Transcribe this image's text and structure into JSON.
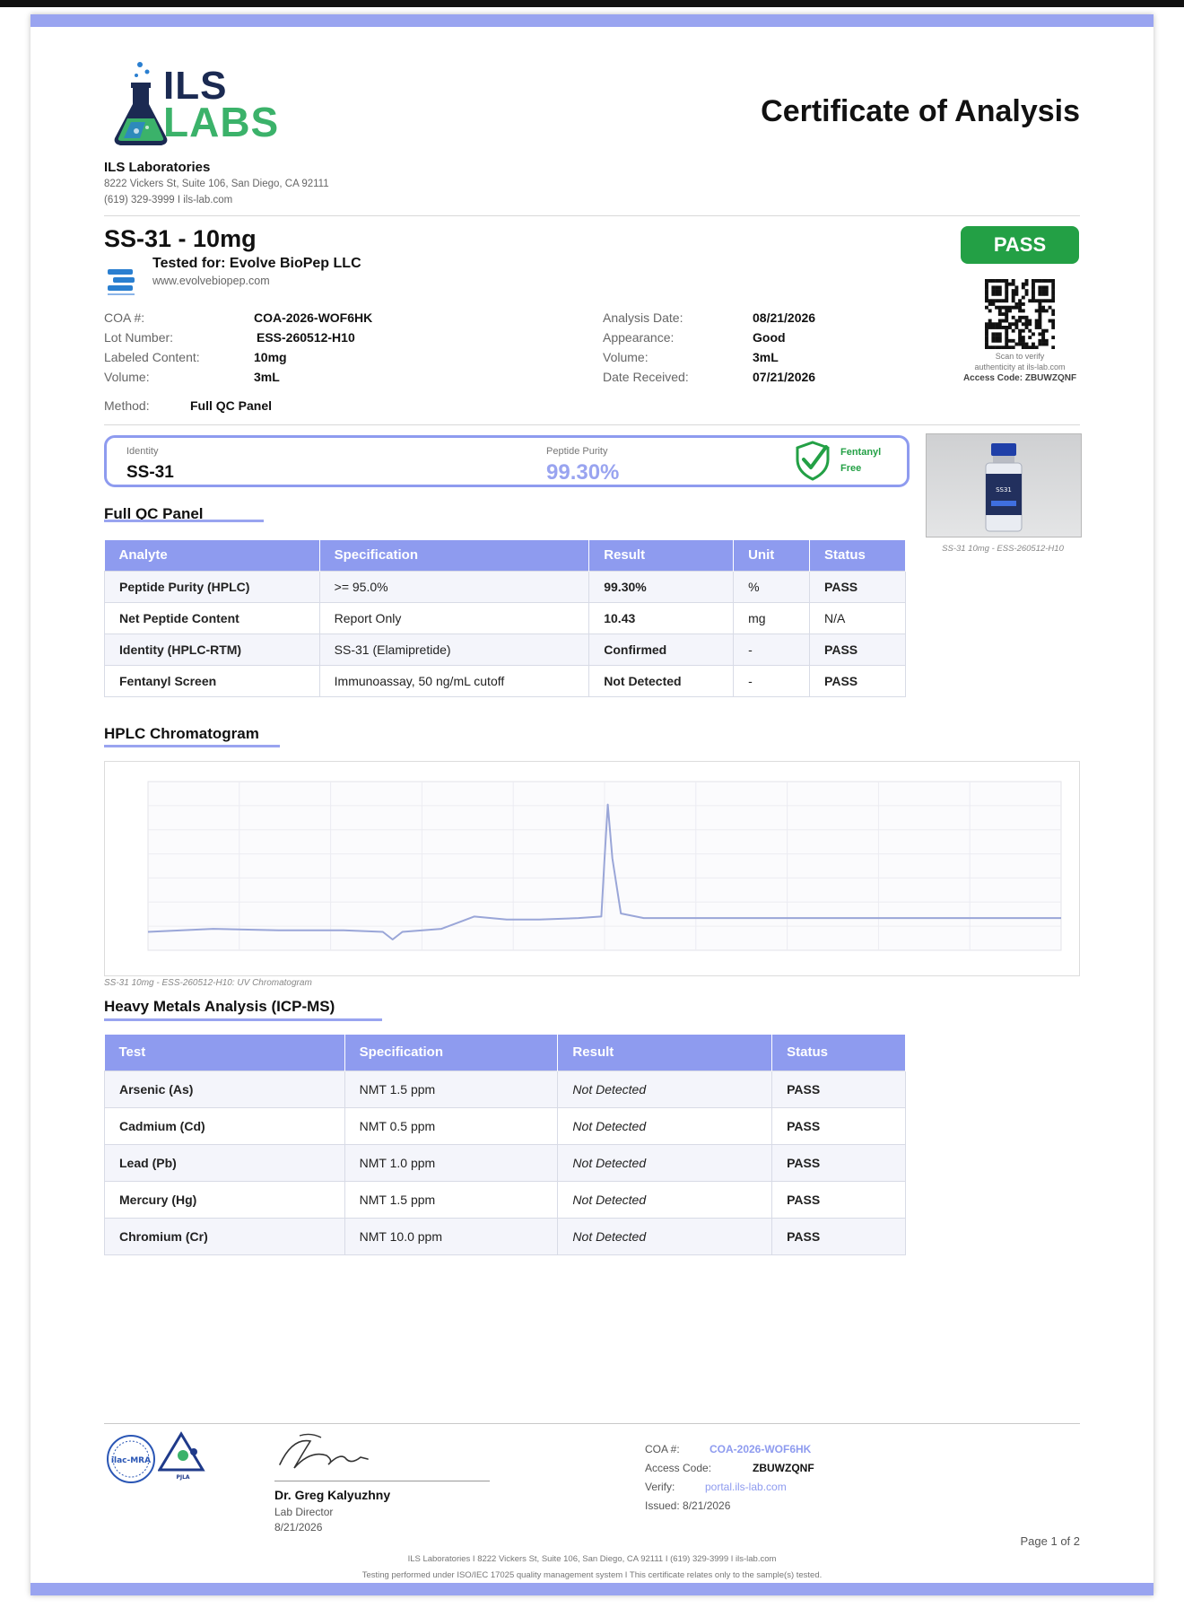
{
  "header": {
    "logo_top": "ILS",
    "logo_bottom": "LABS",
    "title": "Certificate of Analysis",
    "lab_name": "ILS Laboratories",
    "address": "8222 Vickers St, Suite 106, San Diego, CA 92111",
    "contact": "(619) 329-3999  I  ils-lab.com"
  },
  "product": {
    "title": "SS-31 - 10mg",
    "tested_for": "Tested for: Evolve BioPep LLC",
    "client_url": "www.evolvebiopep.com",
    "status": "PASS"
  },
  "meta_left": [
    {
      "label": "COA #:",
      "value": "COA-2026-WOF6HK"
    },
    {
      "label": "Lot Number:",
      "value": "ESS-260512-H10"
    },
    {
      "label": "Labeled Content:",
      "value": "10mg"
    },
    {
      "label": "Volume:",
      "value": "3mL"
    }
  ],
  "meta_right": [
    {
      "label": "Analysis Date:",
      "value": "08/21/2026"
    },
    {
      "label": "Appearance:",
      "value": "Good"
    },
    {
      "label": "Volume:",
      "value": "3mL"
    },
    {
      "label": "Date Received:",
      "value": "07/21/2026"
    }
  ],
  "method": {
    "label": "Method:",
    "value": "Full QC Panel"
  },
  "qr": {
    "caption_1": "Scan to verify",
    "caption_2": "authenticity at ils-lab.com",
    "access": "Access Code: ZBUWZQNF"
  },
  "summary": {
    "identity_label": "Identity",
    "identity_value": "SS-31",
    "purity_label": "Peptide Purity",
    "purity_value": "99.30%",
    "fentanyl_1": "Fentanyl",
    "fentanyl_2": "Free"
  },
  "vial": {
    "label": "SS31",
    "caption": "SS-31 10mg -  ESS-260512-H10"
  },
  "qc_panel": {
    "title": "Full QC Panel",
    "headers": [
      "Analyte",
      "Specification",
      "Result",
      "Unit",
      "Status"
    ],
    "rows": [
      [
        "Peptide Purity (HPLC)",
        ">= 95.0%",
        "99.30%",
        "%",
        "PASS"
      ],
      [
        "Net Peptide Content",
        "Report Only",
        "10.43",
        "mg",
        "N/A"
      ],
      [
        "Identity (HPLC-RTM)",
        "SS-31 (Elamipretide)",
        "Confirmed",
        "-",
        "PASS"
      ],
      [
        "Fentanyl Screen",
        "Immunoassay, 50 ng/mL cutoff",
        "Not Detected",
        "-",
        "PASS"
      ]
    ]
  },
  "chromatogram": {
    "title": "HPLC Chromatogram",
    "caption": "SS-31 10mg -  ESS-260512-H10: UV Chromatogram",
    "line_color": "#9aa6d8"
  },
  "chart_data": {
    "type": "line",
    "x": [
      0,
      1,
      2,
      3,
      3.6,
      3.75,
      3.9,
      4.5,
      5,
      5.5,
      6,
      6.6,
      6.95,
      7.0,
      7.05,
      7.12,
      7.25,
      7.6,
      8,
      9,
      10,
      11,
      12,
      13,
      14
    ],
    "y": [
      2,
      4,
      3,
      3,
      2,
      -3,
      2,
      4,
      12,
      10,
      10,
      11,
      12,
      50,
      85,
      50,
      14,
      11,
      11,
      11,
      11,
      11,
      11,
      11,
      11
    ],
    "xlim": [
      0,
      14
    ],
    "ylim": [
      -10,
      100
    ],
    "grid": true,
    "legend": "none"
  },
  "metals": {
    "title": "Heavy Metals Analysis (ICP-MS)",
    "headers": [
      "Test",
      "Specification",
      "Result",
      "Status"
    ],
    "rows": [
      [
        "Arsenic (As)",
        "NMT 1.5 ppm",
        "Not Detected",
        "PASS"
      ],
      [
        "Cadmium (Cd)",
        "NMT 0.5 ppm",
        "Not Detected",
        "PASS"
      ],
      [
        "Lead (Pb)",
        "NMT 1.0 ppm",
        "Not Detected",
        "PASS"
      ],
      [
        "Mercury (Hg)",
        "NMT 1.5 ppm",
        "Not Detected",
        "PASS"
      ],
      [
        "Chromium (Cr)",
        "NMT 10.0 ppm",
        "Not Detected",
        "PASS"
      ]
    ]
  },
  "footer": {
    "accred_1": "ilac-MRA",
    "accred_2": "PJLA",
    "signer": "Dr. Greg Kalyuzhny",
    "role": "Lab Director",
    "sign_date": "8/21/2026",
    "coa_label": "COA #:",
    "coa_value": "COA-2026-WOF6HK",
    "access_label": "Access Code:",
    "access_value": "ZBUWZQNF",
    "verify_label": "Verify:",
    "verify_value": "portal.ils-lab.com",
    "issued": "Issued: 8/21/2026",
    "page": "Page 1 of 2",
    "line1": "ILS Laboratories  I  8222 Vickers St, Suite 106, San Diego, CA 92111  I  (619) 329-3999  I  ils-lab.com",
    "line2": "Testing performed under ISO/IEC 17025 quality management system  I  This certificate relates only to the sample(s) tested."
  }
}
